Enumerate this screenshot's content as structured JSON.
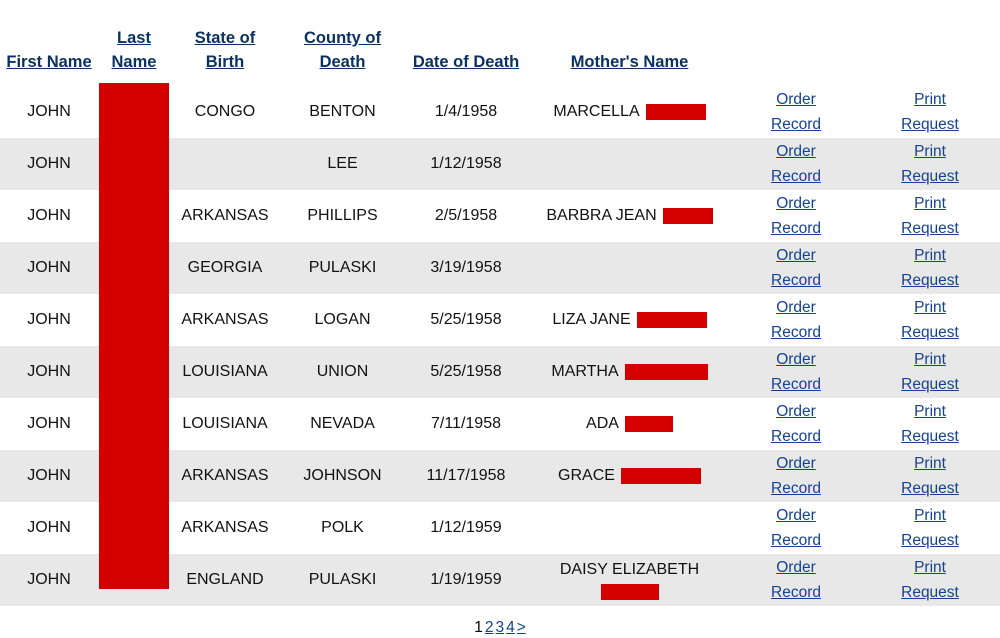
{
  "table": {
    "columns": [
      {
        "key": "first_name",
        "label": "First Name",
        "sortable": true
      },
      {
        "key": "last_name",
        "label": "Last Name",
        "sortable": true
      },
      {
        "key": "state_birth",
        "label": "State of Birth",
        "sortable": true
      },
      {
        "key": "county_death",
        "label": "County of Death",
        "sortable": true
      },
      {
        "key": "date_death",
        "label": "Date of Death",
        "sortable": true
      },
      {
        "key": "mother_name",
        "label": "Mother's Name",
        "sortable": true
      },
      {
        "key": "order",
        "label": "",
        "sortable": false
      },
      {
        "key": "print",
        "label": "",
        "sortable": false
      }
    ],
    "action_labels": {
      "order_line1": "Order",
      "order_line2": "Record",
      "print_line1": "Print",
      "print_line2": "Request"
    },
    "rows": [
      {
        "first_name": "JOHN",
        "last_name": "",
        "last_name_redacted": true,
        "state_birth": "CONGO",
        "county_death": "BENTON",
        "date_death": "1/4/1958",
        "mother_name": "MARCELLA",
        "mother_redaction_width": 60,
        "mother_wrapped": false
      },
      {
        "first_name": "JOHN",
        "last_name": "",
        "last_name_redacted": true,
        "state_birth": "",
        "county_death": "LEE",
        "date_death": "1/12/1958",
        "mother_name": "",
        "mother_redaction_width": 0,
        "mother_wrapped": false
      },
      {
        "first_name": "JOHN",
        "last_name": "",
        "last_name_redacted": true,
        "state_birth": "ARKANSAS",
        "county_death": "PHILLIPS",
        "date_death": "2/5/1958",
        "mother_name": "BARBRA JEAN",
        "mother_redaction_width": 50,
        "mother_wrapped": false
      },
      {
        "first_name": "JOHN",
        "last_name": "",
        "last_name_redacted": true,
        "state_birth": "GEORGIA",
        "county_death": "PULASKI",
        "date_death": "3/19/1958",
        "mother_name": "",
        "mother_redaction_width": 0,
        "mother_wrapped": false
      },
      {
        "first_name": "JOHN",
        "last_name": "",
        "last_name_redacted": true,
        "state_birth": "ARKANSAS",
        "county_death": "LOGAN",
        "date_death": "5/25/1958",
        "mother_name": "LIZA JANE",
        "mother_redaction_width": 70,
        "mother_wrapped": false
      },
      {
        "first_name": "JOHN",
        "last_name": "",
        "last_name_redacted": true,
        "state_birth": "LOUISIANA",
        "county_death": "UNION",
        "date_death": "5/25/1958",
        "mother_name": "MARTHA",
        "mother_redaction_width": 83,
        "mother_wrapped": false
      },
      {
        "first_name": "JOHN",
        "last_name": "",
        "last_name_redacted": true,
        "state_birth": "LOUISIANA",
        "county_death": "NEVADA",
        "date_death": "7/11/1958",
        "mother_name": "ADA",
        "mother_redaction_width": 48,
        "mother_wrapped": false
      },
      {
        "first_name": "JOHN",
        "last_name": "",
        "last_name_redacted": true,
        "state_birth": "ARKANSAS",
        "county_death": "JOHNSON",
        "date_death": "11/17/1958",
        "mother_name": "GRACE",
        "mother_redaction_width": 80,
        "mother_wrapped": false
      },
      {
        "first_name": "JOHN",
        "last_name": "",
        "last_name_redacted": true,
        "state_birth": "ARKANSAS",
        "county_death": "POLK",
        "date_death": "1/12/1959",
        "mother_name": "",
        "mother_redaction_width": 0,
        "mother_wrapped": false
      },
      {
        "first_name": "JOHN",
        "last_name": "",
        "last_name_redacted": true,
        "state_birth": "ENGLAND",
        "county_death": "PULASKI",
        "date_death": "1/19/1959",
        "mother_name": "DAISY ELIZABETH",
        "mother_redaction_width": 58,
        "mother_wrapped": true
      }
    ]
  },
  "pagination": {
    "current_page": "1",
    "pages": [
      "2",
      "3",
      "4"
    ],
    "next_label": ">"
  },
  "colors": {
    "redaction": "#d40000",
    "header_link": "#0b3161",
    "action_link": "#14428e",
    "row_alt_background": "#e8e8e8",
    "row_background": "#ffffff"
  }
}
